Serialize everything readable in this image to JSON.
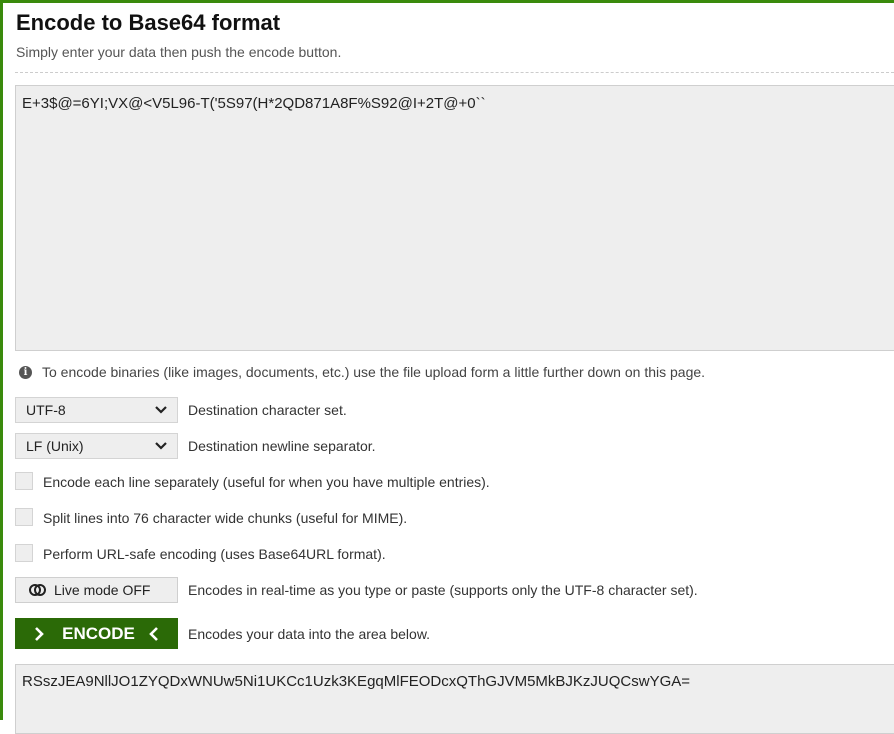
{
  "header": {
    "title": "Encode to Base64 format",
    "subtitle": "Simply enter your data then push the encode button."
  },
  "input": {
    "value": "E+3$@=6YI;VX@<V5L96-T('5S97(H*2QD871A8F%S92@I+2T@+0``"
  },
  "info": {
    "icon": "info-icon",
    "text": "To encode binaries (like images, documents, etc.) use the file upload form a little further down on this page."
  },
  "options": {
    "charset": {
      "selected": "UTF-8",
      "label": "Destination character set."
    },
    "newline": {
      "selected": "LF (Unix)",
      "label": "Destination newline separator."
    },
    "each_line": {
      "checked": false,
      "label": "Encode each line separately (useful for when you have multiple entries)."
    },
    "split_lines": {
      "checked": false,
      "label": "Split lines into 76 character wide chunks (useful for MIME)."
    },
    "url_safe": {
      "checked": false,
      "label": "Perform URL-safe encoding (uses Base64URL format)."
    }
  },
  "live_mode": {
    "button_label": "Live mode OFF",
    "description": "Encodes in real-time as you type or paste (supports only the UTF-8 character set)."
  },
  "encode": {
    "button_label": "ENCODE",
    "description": "Encodes your data into the area below."
  },
  "output": {
    "value": "RSszJEA9NllJO1ZYQDxWNUw5Ni1UKCc1Uzk3KEgqMlFEODcxQThGJVM5MkBJKzJUQCswYGA="
  },
  "colors": {
    "accent": "#2b6a07",
    "frame": "#3a8a0c",
    "field_bg": "#eeeeee"
  }
}
